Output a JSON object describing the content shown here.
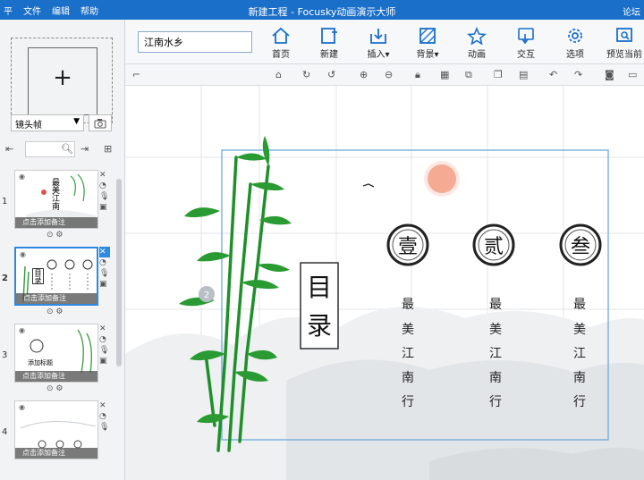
{
  "app": {
    "title": "新建工程 - Focusky动画演示大师",
    "menu": [
      "文件",
      "编辑",
      "帮助"
    ],
    "logo_glyph": "平",
    "forum": "论坛"
  },
  "left": {
    "add_symbol": "+",
    "frame_type": "镜头帧",
    "slides": [
      {
        "num": "1",
        "note": "点击添加备注",
        "thumb_title": "最美江南"
      },
      {
        "num": "2",
        "note": "点击添加备注",
        "thumb_title": "目录"
      },
      {
        "num": "3",
        "note": "点击添加备注",
        "thumb_title": "添加标题"
      },
      {
        "num": "4",
        "note": "点击添加备注",
        "thumb_title": ""
      }
    ]
  },
  "toolbar": {
    "title_value": "江南水乡",
    "tools": [
      {
        "label": "首页",
        "icon": "home-icon"
      },
      {
        "label": "新建",
        "icon": "new-icon"
      },
      {
        "label": "插入▾",
        "icon": "insert-icon"
      },
      {
        "label": "背景▾",
        "icon": "background-icon"
      },
      {
        "label": "动画",
        "icon": "animation-icon"
      },
      {
        "label": "交互",
        "icon": "interaction-icon"
      },
      {
        "label": "选项",
        "icon": "settings-icon"
      },
      {
        "label": "预览当前",
        "icon": "preview-icon"
      }
    ]
  },
  "canvas": {
    "toc_title": "目录",
    "chapters": [
      {
        "numeral": "壹",
        "lines": [
          "最",
          "美",
          "江",
          "南",
          "行"
        ]
      },
      {
        "numeral": "贰",
        "lines": [
          "最",
          "美",
          "江",
          "南",
          "行"
        ]
      },
      {
        "numeral": "叁",
        "lines": [
          "最",
          "美",
          "江",
          "南",
          "行"
        ]
      }
    ],
    "frame_badge": "2",
    "colors": {
      "sun": "#f5a48c",
      "bamboo": "#1f8f2a",
      "frame": "#6ea8e0"
    }
  }
}
